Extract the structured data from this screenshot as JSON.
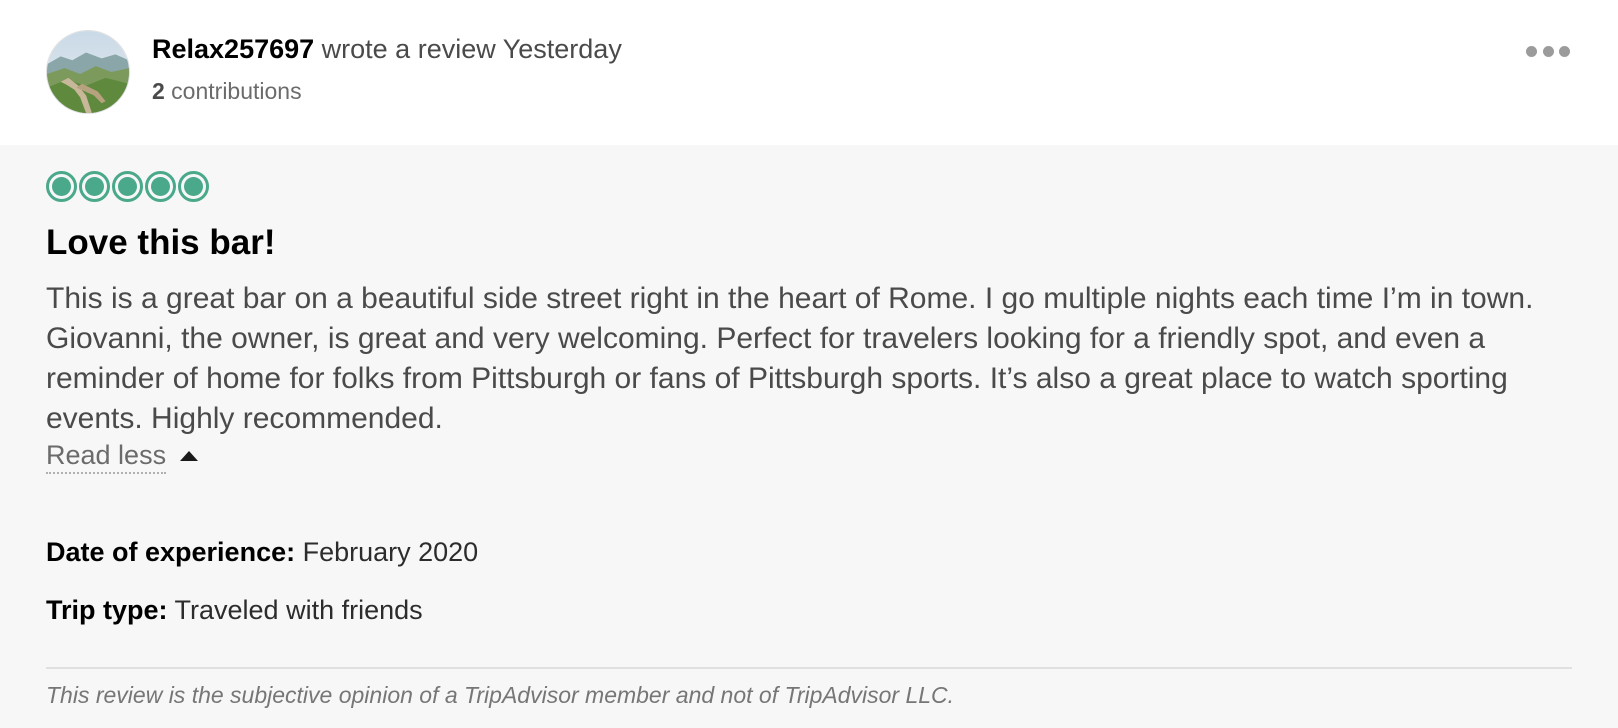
{
  "review": {
    "author": {
      "name": "Relax257697",
      "action": " wrote a review ",
      "when": "Yesterday",
      "contributions_count": "2",
      "contributions_label": " contributions"
    },
    "rating": {
      "value": 5,
      "max": 5,
      "bubble_color": "#4aa88b"
    },
    "title": "Love this bar!",
    "text": "This is a great bar on a beautiful side street right in the heart of Rome. I go multiple nights each time I’m in town. Giovanni, the owner, is great and very welcoming. Perfect for travelers looking for a friendly spot, and even a reminder of home for folks from Pittsburgh or fans of Pittsburgh sports. It’s also a great place to watch sporting events. Highly recommended.",
    "read_less_label": "Read less",
    "details": {
      "date_label": "Date of experience:",
      "date_value": " February 2020",
      "trip_label": "Trip type:",
      "trip_value": " Traveled with friends"
    },
    "disclaimer": "This review is the subjective opinion of a TripAdvisor member and not of TripAdvisor LLC."
  },
  "icons": {
    "more": "more-options-icon",
    "read_less": "caret-up-icon",
    "avatar": "avatar-photo"
  }
}
